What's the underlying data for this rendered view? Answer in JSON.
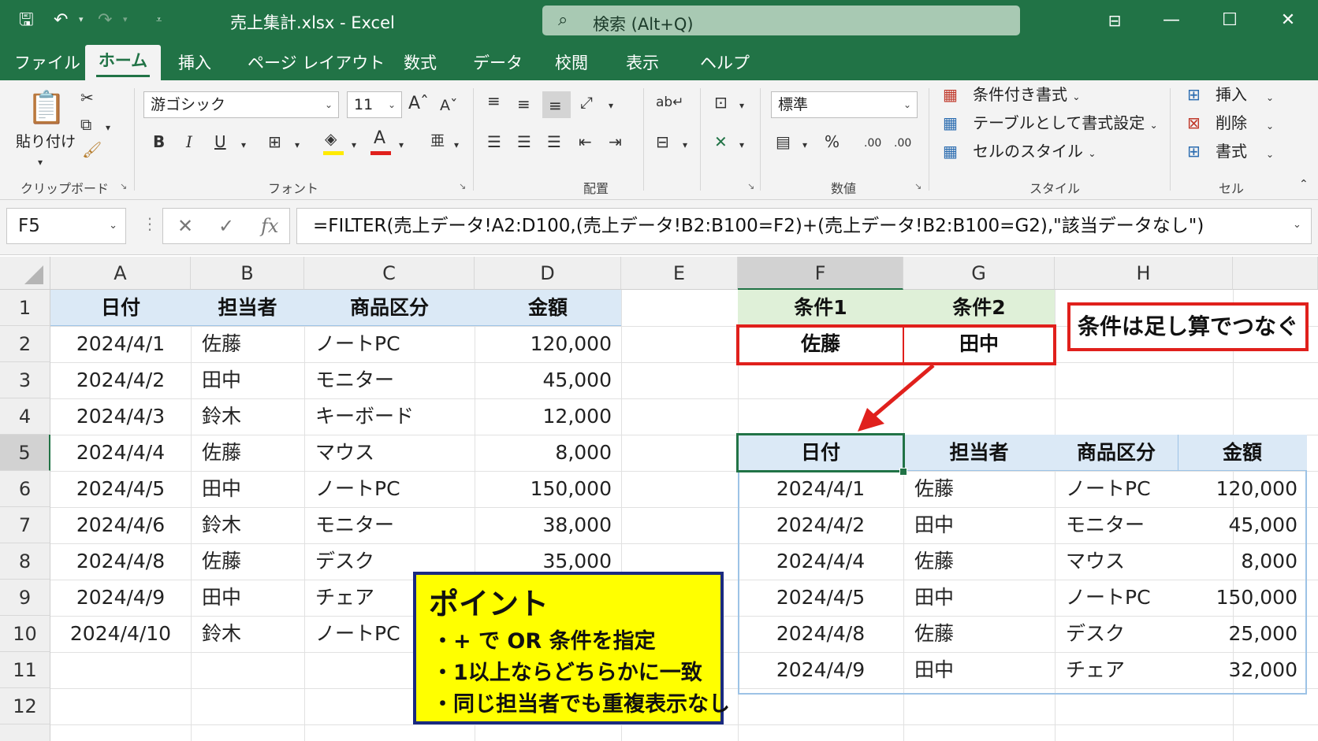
{
  "titlebar": {
    "doc_title": "売上集計.xlsx  -  Excel",
    "search_text": "検索 (Alt+Q)",
    "undo_icon": "undo-icon",
    "redo_icon": "redo-icon"
  },
  "menu": {
    "tabs": [
      "ファイル",
      "ホーム",
      "挿入",
      "ページ レイアウト",
      "数式",
      "データ",
      "校閲",
      "表示",
      "ヘルプ"
    ]
  },
  "ribbon": {
    "paste_label": "貼り付け",
    "clipboard_label": "クリップボード",
    "font_name": "游ゴシック",
    "font_size": "11",
    "font_label": "フォント",
    "align_label": "配置",
    "number_format": "標準",
    "number_label": "数値",
    "style_cond": "条件付き書式",
    "style_table": "テーブルとして書式設定",
    "style_cell": "セルのスタイル",
    "style_label": "スタイル",
    "cell_insert": "挿入",
    "cell_delete": "削除",
    "cell_format": "書式",
    "cell_label": "セル"
  },
  "formula_bar": {
    "name_box": "F5",
    "formula": "=FILTER(売上データ!A2:D100,(売上データ!B2:B100=F2)+(売上データ!B2:B100=G2),\"該当データなし\")"
  },
  "columns": [
    "A",
    "B",
    "C",
    "D",
    "E",
    "F",
    "G",
    "H"
  ],
  "rows": [
    "1",
    "2",
    "3",
    "4",
    "5",
    "6",
    "7",
    "8",
    "9",
    "10",
    "11",
    "12"
  ],
  "source_table": {
    "headers": [
      "日付",
      "担当者",
      "商品区分",
      "金額"
    ],
    "rows": [
      [
        "2024/4/1",
        "佐藤",
        "ノートPC",
        "120,000"
      ],
      [
        "2024/4/2",
        "田中",
        "モニター",
        "45,000"
      ],
      [
        "2024/4/3",
        "鈴木",
        "キーボード",
        "12,000"
      ],
      [
        "2024/4/4",
        "佐藤",
        "マウス",
        "8,000"
      ],
      [
        "2024/4/5",
        "田中",
        "ノートPC",
        "150,000"
      ],
      [
        "2024/4/6",
        "鈴木",
        "モニター",
        "38,000"
      ],
      [
        "2024/4/8",
        "佐藤",
        "デスク",
        "35,000"
      ],
      [
        "2024/4/9",
        "田中",
        "チェア",
        ""
      ],
      [
        "2024/4/10",
        "鈴木",
        "ノートPC",
        ""
      ]
    ]
  },
  "criteria": {
    "headers": [
      "条件1",
      "条件2"
    ],
    "values": [
      "佐藤",
      "田中"
    ],
    "note": "条件は足し算でつなぐ"
  },
  "result_table": {
    "headers": [
      "日付",
      "担当者",
      "商品区分",
      "金額"
    ],
    "rows": [
      [
        "2024/4/1",
        "佐藤",
        "ノートPC",
        "120,000"
      ],
      [
        "2024/4/2",
        "田中",
        "モニター",
        "45,000"
      ],
      [
        "2024/4/4",
        "佐藤",
        "マウス",
        "8,000"
      ],
      [
        "2024/4/5",
        "田中",
        "ノートPC",
        "150,000"
      ],
      [
        "2024/4/8",
        "佐藤",
        "デスク",
        "25,000"
      ],
      [
        "2024/4/9",
        "田中",
        "チェア",
        "32,000"
      ]
    ]
  },
  "callout": {
    "title": "ポイント",
    "bullets": [
      "・+ で OR 条件を指定",
      "・1以上ならどちらかに一致",
      "・同じ担当者でも重複表示なし"
    ]
  },
  "colors": {
    "excel_green": "#217346",
    "header_blue": "#dbe9f6",
    "criteria_green": "#dff0d8",
    "highlight_red": "#e0201c",
    "callout_yellow": "#ffff00",
    "callout_border": "#1a2a80"
  }
}
